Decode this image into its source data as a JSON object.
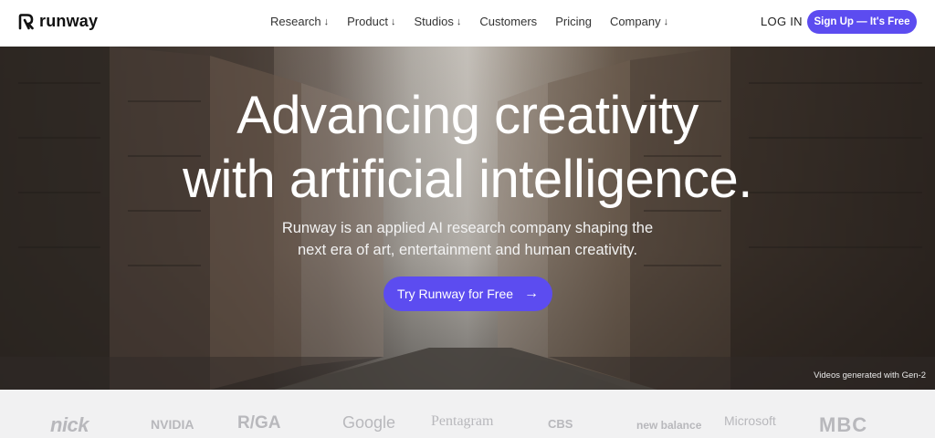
{
  "header": {
    "logo_text": "runway",
    "nav": [
      {
        "label": "Research",
        "arrow": "↓"
      },
      {
        "label": "Product",
        "arrow": "↓"
      },
      {
        "label": "Studios",
        "arrow": "↓"
      },
      {
        "label": "Customers",
        "arrow": ""
      },
      {
        "label": "Pricing",
        "arrow": ""
      },
      {
        "label": "Company",
        "arrow": "↓"
      }
    ],
    "login_label": "LOG IN",
    "signup_label": "Sign Up — It's Free"
  },
  "hero": {
    "title_line1": "Advancing creativity",
    "title_line2": "with artificial intelligence.",
    "subtitle_line1": "Runway is an applied AI research company shaping the",
    "subtitle_line2": "next era of art, entertainment and human creativity.",
    "cta_label": "Try Runway for Free",
    "cta_arrow": "→",
    "caption": "Videos generated with Gen-2"
  },
  "brands": [
    "nick",
    "NVIDIA",
    "R/GA",
    "Google",
    "Pentagram",
    "CBS",
    "new balance",
    "Microsoft",
    "MBC"
  ],
  "colors": {
    "accent": "#5c4cf0",
    "brand_logo_gray": "#b8b8bc",
    "strip_background": "#f1f1f2"
  }
}
